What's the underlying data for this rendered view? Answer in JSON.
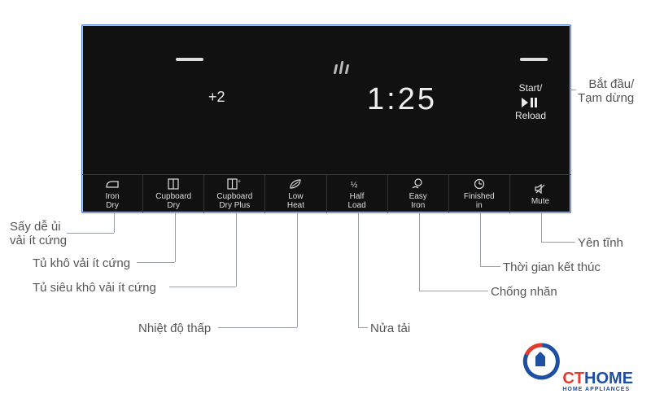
{
  "display": {
    "level_adjust": "+2",
    "time": "1:25",
    "start_label": "Start/",
    "reload_label": "Reload"
  },
  "buttons": [
    {
      "id": "iron-dry",
      "label": "Iron\nDry",
      "icon": "iron"
    },
    {
      "id": "cupboard-dry",
      "label": "Cupboard\nDry",
      "icon": "cupboard"
    },
    {
      "id": "cupboard-dry-plus",
      "label": "Cupboard\nDry Plus",
      "icon": "cupboard-plus"
    },
    {
      "id": "low-heat",
      "label": "Low\nHeat",
      "icon": "leaf"
    },
    {
      "id": "half-load",
      "label": "Half\nLoad",
      "icon": "half"
    },
    {
      "id": "easy-iron",
      "label": "Easy\nIron",
      "icon": "easy-iron"
    },
    {
      "id": "finished-in",
      "label": "Finished\nin",
      "icon": "clock"
    },
    {
      "id": "mute",
      "label": "Mute",
      "icon": "mute"
    }
  ],
  "callouts": {
    "start_pause": "Bắt đầu/\nTạm dừng",
    "mute": "Yên tĩnh",
    "finished_in": "Thời gian kết thúc",
    "easy_iron": "Chống nhăn",
    "half_load": "Nửa tải",
    "low_heat": "Nhiệt độ thấp",
    "cupboard_dry_plus": "Tủ siêu khô vải ít cứng",
    "cupboard_dry": "Tủ khô vải ít cứng",
    "iron_dry": "Sấy dễ ủi\nvải ít cứng"
  },
  "logo": {
    "brand_left": "CT",
    "brand_right": "HOME",
    "sub": "HOME APPLIANCES"
  },
  "watermark": "CTHOME",
  "watermark_sub": "HOME APPLIANCES"
}
